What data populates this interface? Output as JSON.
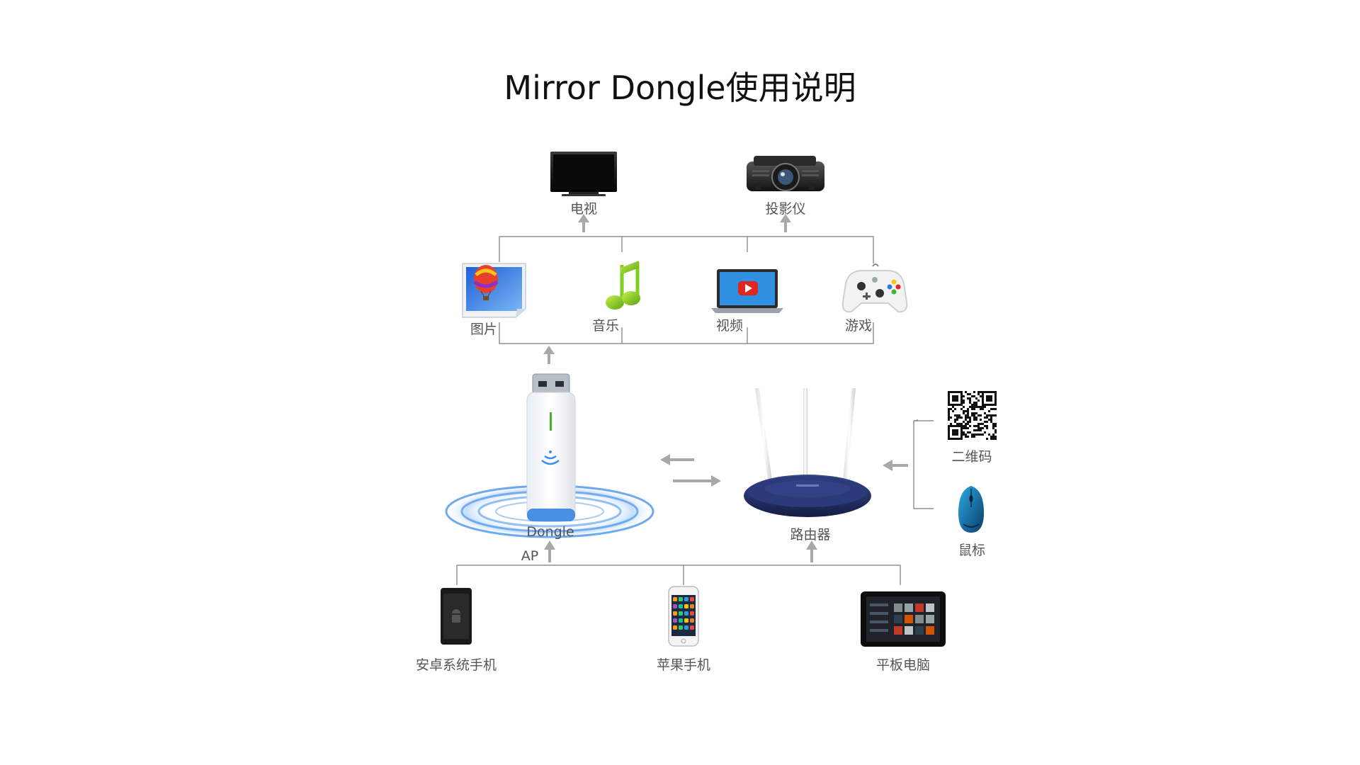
{
  "title": "Mirror Dongle使用说明",
  "outputs": {
    "tv": "电视",
    "projector": "投影仪"
  },
  "media": {
    "photo": "图片",
    "music": "音乐",
    "video": "视频",
    "game": "游戏"
  },
  "center": {
    "dongle": "Dongle",
    "ap": "AP",
    "router": "路由器"
  },
  "control": {
    "qrcode": "二维码",
    "mouse": "鼠标"
  },
  "sources": {
    "android": "安卓系统手机",
    "iphone": "苹果手机",
    "tablet": "平板电脑"
  },
  "colors": {
    "line": "#7a7a7a",
    "arrow": "#a8a8a8",
    "ring": "#3f8ee8",
    "router": "#1f2a5c",
    "screen": "#111111"
  }
}
